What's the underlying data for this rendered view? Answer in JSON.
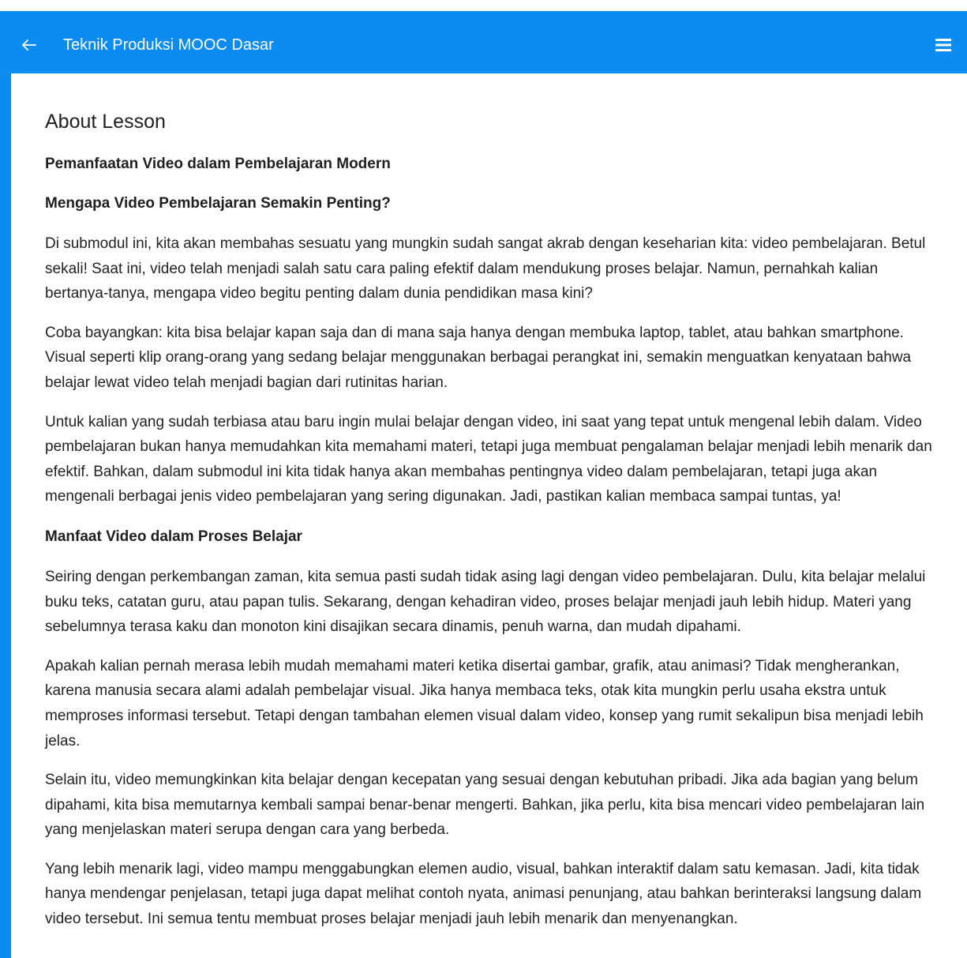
{
  "topbar": {
    "back_icon": "arrow-left-icon",
    "title": "Teknik Produksi MOOC Dasar",
    "menu_icon": "hamburger-menu-icon",
    "color": "#0b8cf2"
  },
  "lesson": {
    "heading": "About Lesson",
    "title": "Pemanfaatan Video dalam Pembelajaran Modern",
    "section1_heading": "Mengapa Video Pembelajaran Semakin Penting?",
    "section1_paragraphs": [
      "Di submodul ini, kita akan membahas sesuatu yang mungkin sudah sangat akrab dengan keseharian kita: video pembelajaran. Betul sekali! Saat ini, video telah menjadi salah satu cara paling efektif dalam mendukung proses belajar. Namun, pernahkah kalian bertanya-tanya, mengapa video begitu penting dalam dunia pendidikan masa kini?",
      "Coba bayangkan: kita bisa belajar kapan saja dan di mana saja hanya dengan membuka laptop, tablet, atau bahkan smartphone. Visual seperti klip orang-orang yang sedang belajar menggunakan berbagai perangkat ini, semakin menguatkan kenyataan bahwa belajar lewat video telah menjadi bagian dari rutinitas harian.",
      "Untuk kalian yang sudah terbiasa atau baru ingin mulai belajar dengan video, ini saat yang tepat untuk mengenal lebih dalam. Video pembelajaran bukan hanya memudahkan kita memahami materi, tetapi juga membuat pengalaman belajar menjadi lebih menarik dan efektif. Bahkan, dalam submodul ini kita tidak hanya akan membahas pentingnya video dalam pembelajaran, tetapi juga akan mengenali berbagai jenis video pembelajaran yang sering digunakan. Jadi, pastikan kalian membaca sampai tuntas, ya!"
    ],
    "section2_heading": "Manfaat Video dalam Proses Belajar",
    "section2_paragraphs": [
      "Seiring dengan perkembangan zaman, kita semua pasti sudah tidak asing lagi dengan video pembelajaran. Dulu, kita belajar melalui buku teks, catatan guru, atau papan tulis. Sekarang, dengan kehadiran video, proses belajar menjadi jauh lebih hidup. Materi yang sebelumnya terasa kaku dan monoton kini disajikan secara dinamis, penuh warna, dan mudah dipahami.",
      "Apakah kalian pernah merasa lebih mudah memahami materi ketika disertai gambar, grafik, atau animasi? Tidak mengherankan, karena manusia secara alami adalah pembelajar visual. Jika hanya membaca teks, otak kita mungkin perlu usaha ekstra untuk memproses informasi tersebut. Tetapi dengan tambahan elemen visual dalam video, konsep yang rumit sekalipun bisa menjadi lebih jelas.",
      "Selain itu, video memungkinkan kita belajar dengan kecepatan yang sesuai dengan kebutuhan pribadi. Jika ada bagian yang belum dipahami, kita bisa memutarnya kembali sampai benar-benar mengerti. Bahkan, jika perlu, kita bisa mencari video pembelajaran lain yang menjelaskan materi serupa dengan cara yang berbeda.",
      "Yang lebih menarik lagi, video mampu menggabungkan elemen audio, visual, bahkan interaktif dalam satu kemasan. Jadi, kita tidak hanya mendengar penjelasan, tetapi juga dapat melihat contoh nyata, animasi penunjang, atau bahkan berinteraksi langsung dalam video tersebut. Ini semua tentu membuat proses belajar menjadi jauh lebih menarik dan menyenangkan."
    ]
  }
}
